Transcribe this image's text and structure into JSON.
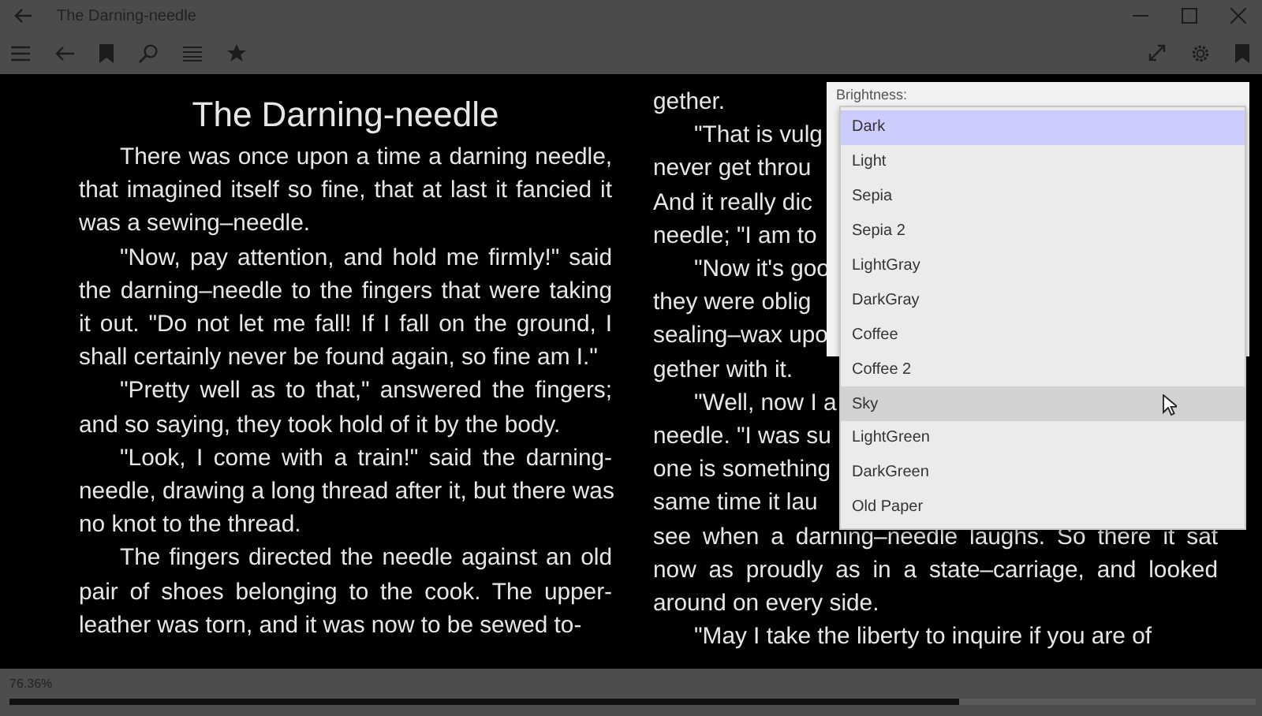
{
  "window": {
    "title": "The Darning-needle"
  },
  "page": {
    "title": "The Darning-needle",
    "column_1": [
      {
        "indent": true,
        "lines": [
          "There was once upon a time a darning needle,",
          "that imagined itself so fine, that at last it fancied it",
          "was a sewing–needle."
        ]
      },
      {
        "indent": true,
        "lines": [
          "\"Now, pay attention, and hold me firmly!\" said",
          "the darning–needle to the fingers that were taking",
          "it out. \"Do not let me fall! If I fall on the ground, I",
          "shall certainly never be found again, so fine am I.\""
        ]
      },
      {
        "indent": true,
        "lines": [
          "\"Pretty well as to that,\" answered the fingers;",
          "and so saying, they took hold of it by the body."
        ]
      },
      {
        "indent": true,
        "lines": [
          "\"Look, I come with a train!\" said the darning-",
          "needle, drawing a long thread after it, but there was",
          "no knot to the thread."
        ]
      },
      {
        "indent": true,
        "lines": [
          "The fingers directed the needle against an old",
          "pair of shoes belonging to the cook. The upper-",
          "leather was torn, and it was now to be sewed to-"
        ]
      }
    ],
    "column_2": [
      {
        "indent": false,
        "lines": [
          "gether."
        ]
      },
      {
        "indent": true,
        "lines": [
          {
            "text": "\"That is vulg",
            "cut": true
          },
          {
            "text": "never get throu",
            "cut": true
          },
          {
            "text": "And it really dic",
            "cut": true
          },
          "needle; \"I am to"
        ]
      },
      {
        "indent": true,
        "lines": [
          {
            "text": "\"Now it's goo",
            "cut": true
          },
          {
            "text": "they were oblig",
            "cut": true
          },
          {
            "text": "sealing–wax upo",
            "cut": true
          },
          "gether with it."
        ]
      },
      {
        "indent": true,
        "lines": [
          {
            "text": "\"Well, now I a",
            "cut": true
          },
          {
            "text": "needle. \"I was su",
            "cut": true
          },
          {
            "text": "one is something",
            "cut": true
          },
          {
            "text": "same time it lau",
            "cut": true
          },
          {
            "text": "see when a darning–needle laughs. So there it sat",
            "cut": false
          },
          {
            "text": "now as proudly as in a state–carriage, and looked",
            "cut": false
          },
          "around on every side."
        ]
      },
      {
        "indent": true,
        "lines": [
          "\"May I take the liberty to inquire if you are of"
        ]
      }
    ]
  },
  "settings_panel": {
    "label": "Brightness:",
    "theme_list": [
      {
        "label": "Dark",
        "selected": true,
        "hovered": false
      },
      {
        "label": "Light",
        "selected": false,
        "hovered": false
      },
      {
        "label": "Sepia",
        "selected": false,
        "hovered": false
      },
      {
        "label": "Sepia 2",
        "selected": false,
        "hovered": false
      },
      {
        "label": "LightGray",
        "selected": false,
        "hovered": false
      },
      {
        "label": "DarkGray",
        "selected": false,
        "hovered": false
      },
      {
        "label": "Coffee",
        "selected": false,
        "hovered": false
      },
      {
        "label": "Coffee 2",
        "selected": false,
        "hovered": false
      },
      {
        "label": "Sky",
        "selected": false,
        "hovered": true
      },
      {
        "label": "LightGreen",
        "selected": false,
        "hovered": false
      },
      {
        "label": "DarkGreen",
        "selected": false,
        "hovered": false
      },
      {
        "label": "Old Paper",
        "selected": false,
        "hovered": false
      }
    ]
  },
  "status_bar": {
    "progress_text": "76.36%",
    "level": 0.762
  }
}
